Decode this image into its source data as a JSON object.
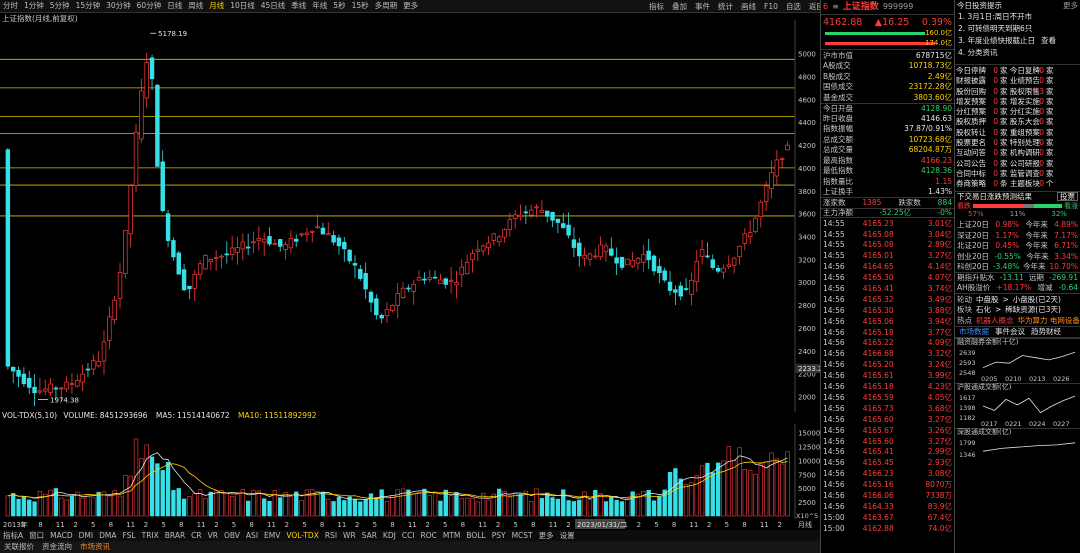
{
  "toolbar": {
    "periods": [
      "分时",
      "1分钟",
      "5分钟",
      "15分钟",
      "30分钟",
      "60分钟",
      "日线",
      "周线",
      "月线",
      "10日线",
      "45日线",
      "季线",
      "年线",
      "5秒",
      "15秒",
      "多周期",
      "更多"
    ],
    "active_period": "月线",
    "tools": [
      "指标",
      "叠加",
      "事件",
      "统计",
      "画线",
      "F10",
      "自选",
      "返回"
    ]
  },
  "chart": {
    "title": "上证指数(月线,前复权)",
    "price_axis": [
      "5000",
      "4800",
      "4600",
      "4400",
      "4200",
      "4000",
      "3800",
      "3600",
      "3400",
      "3200",
      "3000",
      "2800",
      "2600",
      "2400",
      "2200",
      "2000"
    ],
    "high_label": "5178.19",
    "low_label": "1974.38",
    "cursor_value": "2233.2",
    "date_tag": "2023/01/31/二",
    "vol_header": {
      "name": "VOL-TDX(5,10)",
      "volume": "VOLUME: 8451293696",
      "ma5": "MA5: 11514140672",
      "ma10": "MA10: 11511892992"
    },
    "vol_axis": [
      "15000",
      "12500",
      "10000",
      "7500",
      "5000",
      "2500"
    ],
    "vol_unit": "X10^5",
    "x_labels": [
      "2013年",
      "5",
      "8",
      "11",
      "2",
      "5",
      "8",
      "11",
      "2",
      "5",
      "8",
      "11",
      "2",
      "5",
      "8",
      "11",
      "2",
      "5",
      "8",
      "11",
      "2",
      "5",
      "8",
      "11",
      "2",
      "5",
      "8",
      "11",
      "2",
      "5",
      "8",
      "11",
      "2",
      "5",
      "8",
      "11",
      "2",
      "5",
      "8",
      "11",
      "2",
      "5",
      "8",
      "11",
      "2"
    ],
    "x_right": "月线"
  },
  "chart_data": {
    "type": "candlestick",
    "title": "上证指数(月线,前复权)",
    "ylim": [
      1900,
      5250
    ],
    "annotations": {
      "high": 5178.19,
      "low": 1974.38
    }
  },
  "indicators": {
    "items": [
      "指标A",
      "窗口",
      "MACD",
      "DMI",
      "DMA",
      "FSL",
      "TRIX",
      "BRAR",
      "CR",
      "VR",
      "OBV",
      "ASI",
      "EMV",
      "VOL-TDX",
      "RSI",
      "WR",
      "SAR",
      "KDJ",
      "CCI",
      "ROC",
      "MTM",
      "BOLL",
      "PSY",
      "MCST",
      "更多",
      "设置"
    ],
    "active": "VOL-TDX"
  },
  "bottom_tabs": {
    "items": [
      "关联报价",
      "资金流向",
      "市场资讯"
    ],
    "active": "市场资讯"
  },
  "quote": {
    "code_prefix": "6",
    "name": "上证指数",
    "code": "999999",
    "price": "4162.88",
    "change": "▲16.25",
    "pct": "0.39%",
    "bar1": "160.0亿",
    "bar2": "174.0亿",
    "stats": [
      {
        "k": "沪市市值",
        "v": "678715亿",
        "c": "white"
      },
      {
        "k": "A股成交",
        "v": "10718.73亿",
        "c": "yellow"
      },
      {
        "k": "B股成交",
        "v": "2.49亿",
        "c": "yellow"
      },
      {
        "k": "国债成交",
        "v": "23172.28亿",
        "c": "yellow"
      },
      {
        "k": "基金成交",
        "v": "3803.60亿",
        "c": "yellow"
      },
      {
        "k": "今日开盘",
        "v": "4128.90",
        "c": "green"
      },
      {
        "k": "昨日收盘",
        "v": "4146.63",
        "c": "white"
      },
      {
        "k": "指数振幅",
        "v": "37.87/0.91%",
        "c": "white"
      },
      {
        "k": "总成交额",
        "v": "10723.68亿",
        "c": "yellow"
      },
      {
        "k": "总成交量",
        "v": "68204.87万",
        "c": "yellow"
      },
      {
        "k": "最高指数",
        "v": "4166.23",
        "c": "red"
      },
      {
        "k": "最低指数",
        "v": "4128.36",
        "c": "green"
      },
      {
        "k": "指数量比",
        "v": "1.15",
        "c": "red"
      },
      {
        "k": "上证换手",
        "v": "1.43%",
        "c": "white"
      }
    ],
    "up_label": "涨家数",
    "up": "1385",
    "down_label": "跌家数",
    "down": "884",
    "flow_label": "主力净额",
    "flow": "-52.25亿",
    "flow_pct": "-0%",
    "ticks": [
      [
        "14:55",
        "4165.23",
        "3.01亿"
      ],
      [
        "14:55",
        "4165.08",
        "3.04亿"
      ],
      [
        "14:55",
        "4165.08",
        "2.89亿"
      ],
      [
        "14:55",
        "4165.01",
        "3.27亿"
      ],
      [
        "14:56",
        "4164.65",
        "4.14亿"
      ],
      [
        "14:56",
        "4165.30",
        "4.07亿"
      ],
      [
        "14:56",
        "4165.41",
        "3.74亿"
      ],
      [
        "14:56",
        "4165.32",
        "3.49亿"
      ],
      [
        "14:56",
        "4165.30",
        "3.88亿"
      ],
      [
        "14:56",
        "4165.06",
        "3.94亿"
      ],
      [
        "14:56",
        "4165.18",
        "3.77亿"
      ],
      [
        "14:56",
        "4165.22",
        "4.09亿"
      ],
      [
        "14:56",
        "4166.68",
        "3.32亿"
      ],
      [
        "14:56",
        "4165.20",
        "3.24亿"
      ],
      [
        "14:56",
        "4165.61",
        "3.99亿"
      ],
      [
        "14:56",
        "4165.18",
        "4.23亿"
      ],
      [
        "14:56",
        "4165.59",
        "4.05亿"
      ],
      [
        "14:56",
        "4165.73",
        "3.68亿"
      ],
      [
        "14:56",
        "4165.60",
        "3.27亿"
      ],
      [
        "14:56",
        "4165.67",
        "3.26亿"
      ],
      [
        "14:56",
        "4165.60",
        "3.27亿"
      ],
      [
        "14:56",
        "4165.41",
        "2.99亿"
      ],
      [
        "14:56",
        "4165.45",
        "2.93亿"
      ],
      [
        "14:56",
        "4166.23",
        "3.08亿"
      ],
      [
        "14:56",
        "4165.16",
        "8070万"
      ],
      [
        "14:56",
        "4166.06",
        "7338万"
      ],
      [
        "14:56",
        "4164.33",
        "83.9亿"
      ],
      [
        "15:00",
        "4163.67",
        "67.4亿"
      ],
      [
        "15:00",
        "4162.88",
        "74.0亿"
      ]
    ]
  },
  "news": {
    "title": "今日投资提示",
    "more": "更多",
    "items": [
      {
        "t": "1. 3月1日:周日不开市",
        "c": "white"
      },
      {
        "t": "2. 可转债明天到期6只",
        "c": "white"
      },
      {
        "t": "3. 年度业绩快报截止日",
        "extra": "查看",
        "c": "white"
      },
      {
        "t": "4. 分类资讯",
        "c": "white"
      }
    ]
  },
  "events": [
    [
      "今日停牌",
      "0",
      "家 今日复牌",
      "0",
      "家"
    ],
    [
      "财报披露",
      "0",
      "家 业绩预告",
      "0",
      "家"
    ],
    [
      "股份回购",
      "0",
      "家 股权限售",
      "13",
      "家"
    ],
    [
      "增发预案",
      "0",
      "家 增发实施",
      "0",
      "家"
    ],
    [
      "分红预案",
      "0",
      "家 分红实施",
      "0",
      "家"
    ],
    [
      "股权质押",
      "0",
      "家 股东大会",
      "0",
      "家"
    ],
    [
      "股权转让",
      "0",
      "家 重组预案",
      "0",
      "家"
    ],
    [
      "股票更名",
      "0",
      "家 特别处理",
      "0",
      "家"
    ],
    [
      "互动问答",
      "0",
      "家 机构调研",
      "0",
      "家"
    ],
    [
      "公司公告",
      "0",
      "家 公司研报",
      "0",
      "家"
    ],
    [
      "合同中标",
      "0",
      "家 监管调查",
      "0",
      "家"
    ],
    [
      "券商策略",
      "0",
      "条 主题板块",
      "0",
      "个"
    ]
  ],
  "sentiment": {
    "title": "下交易日涨跌预测结果",
    "btn": "投票",
    "bear": "看跌",
    "bull": "看涨",
    "bear_pct": "57%",
    "mid_pct": "11%",
    "bull_pct": "32%",
    "rows": [
      {
        "k": "上证20日",
        "v": "0.98%",
        "k2": "今年来",
        "v2": "4.89%"
      },
      {
        "k": "深证20日",
        "v": "1.17%",
        "k2": "今年来",
        "v2": "7.17%"
      },
      {
        "k": "北证20日",
        "v": "0.45%",
        "k2": "今年来",
        "v2": "6.71%"
      },
      {
        "k": "创业20日",
        "v": "-0.55%",
        "k2": "今年来",
        "v2": "3.34%"
      },
      {
        "k": "科创20日",
        "v": "-3.48%",
        "k2": "今年来",
        "v2": "10.70%"
      }
    ],
    "m1": {
      "k": "期指升贴水",
      "v": "-13.11",
      "k2": "远期",
      "v2": "-269.91"
    },
    "m2": {
      "k": "AH股溢价",
      "v": "+18.17%",
      "k2": "增减",
      "v2": "-0.64"
    },
    "rot": [
      {
        "k": "轮动",
        "a": "中盘股",
        "b": "小盘股(已2天)"
      },
      {
        "k": "板块",
        "a": "石化",
        "b": "稀缺资源(已3天)"
      },
      {
        "k": "热点",
        "a": "机器人概念",
        "b": "华为算力 电网设备"
      }
    ],
    "tabs": [
      "市场数据",
      "事件会议",
      "趋势财经"
    ]
  },
  "minis": [
    {
      "title": "融资融券余额(十亿)",
      "y": [
        "2639",
        "2593",
        "2548"
      ],
      "x": [
        "0205",
        "0210",
        "0213",
        "0226"
      ]
    },
    {
      "title": "沪股通成交额(亿)",
      "y": [
        "1617",
        "1398",
        "1182"
      ],
      "x": [
        "0217",
        "0221",
        "0224",
        "0227"
      ]
    },
    {
      "title": "深股通成交额(亿)",
      "y": [
        "1799",
        "1346"
      ],
      "x": []
    }
  ],
  "status": {
    "left": "图文F10",
    "right": "拼 稍"
  }
}
